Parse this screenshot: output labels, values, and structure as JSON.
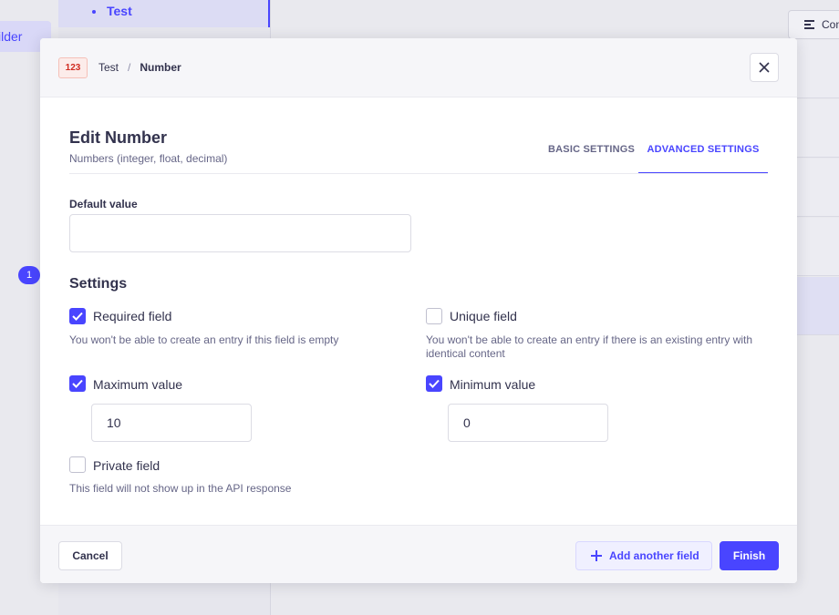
{
  "background": {
    "builder_label": "ilder",
    "badge_count": "1",
    "sidebar_active_item": "Test",
    "configure_label": "Con"
  },
  "header": {
    "type_badge": "123",
    "breadcrumb": [
      "Test",
      "Number"
    ],
    "separator": "/"
  },
  "editor": {
    "title": "Edit Number",
    "subtitle": "Numbers (integer, float, decimal)",
    "tabs": [
      {
        "label": "BASIC SETTINGS",
        "active": false
      },
      {
        "label": "ADVANCED SETTINGS",
        "active": true
      }
    ]
  },
  "default_value": {
    "label": "Default value",
    "value": ""
  },
  "settings": {
    "title": "Settings",
    "required": {
      "label": "Required field",
      "checked": true,
      "hint": "You won't be able to create an entry if this field is empty"
    },
    "unique": {
      "label": "Unique field",
      "checked": false,
      "hint": "You won't be able to create an entry if there is an existing entry with identical content"
    },
    "maximum": {
      "label": "Maximum value",
      "checked": true,
      "value": "10"
    },
    "minimum": {
      "label": "Minimum value",
      "checked": true,
      "value": "0"
    },
    "private": {
      "label": "Private field",
      "checked": false,
      "hint": "This field will not show up in the API response"
    }
  },
  "footer": {
    "cancel_label": "Cancel",
    "add_label": "Add another field",
    "finish_label": "Finish"
  },
  "colors": {
    "primary": "#4945ff",
    "danger": "#d02b20"
  }
}
